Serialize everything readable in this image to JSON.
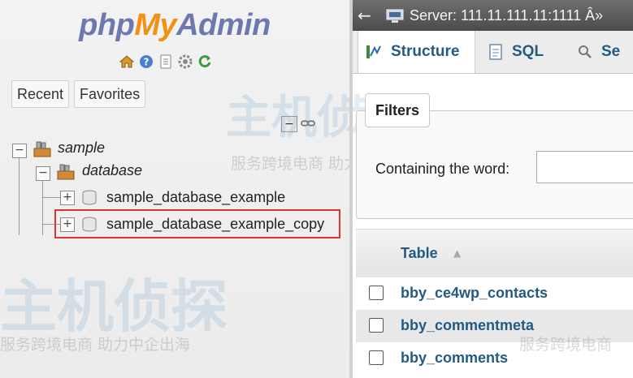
{
  "nav": {
    "logo": {
      "part1": "php",
      "part2": "My",
      "part3": "Admin"
    },
    "icons": [
      "home-icon",
      "help-icon",
      "docs-icon",
      "settings-icon",
      "reload-icon"
    ],
    "tabs": {
      "recent": "Recent",
      "favorites": "Favorites"
    },
    "tree": {
      "root": "sample",
      "child": "database",
      "items": [
        "sample_database_example",
        "sample_database_example_copy"
      ]
    }
  },
  "watermarks": {
    "big": "主机侦探",
    "small": "服务跨境电商 助力中企出海",
    "small_right": "服务跨境电商"
  },
  "main": {
    "server_label": "Server: 111.11.111.11:1111",
    "server_suffix": "Â»",
    "tabs": [
      "Structure",
      "SQL",
      "Se"
    ],
    "filters": {
      "legend": "Filters",
      "label": "Containing the word:",
      "value": ""
    },
    "table": {
      "header": "Table",
      "rows": [
        "bby_ce4wp_contacts",
        "bby_commentmeta",
        "bby_comments"
      ]
    }
  },
  "colors": {
    "link": "#235a81",
    "highlight": "#e03333",
    "logo_blue": "#6c78af",
    "logo_orange": "#f29111"
  }
}
